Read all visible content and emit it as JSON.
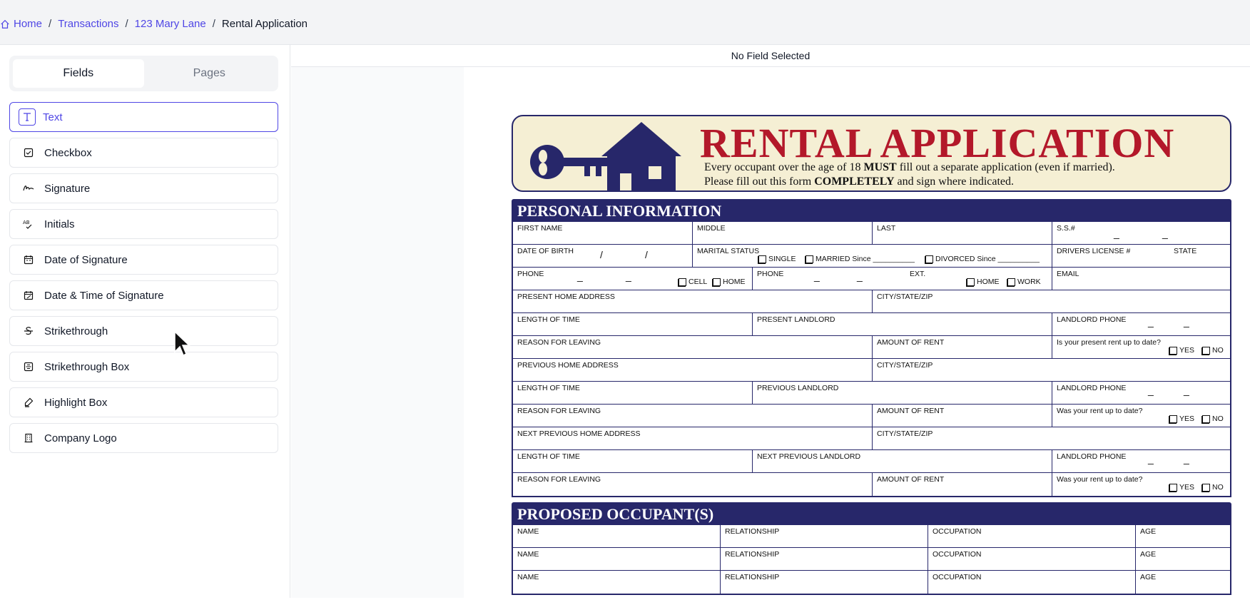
{
  "breadcrumb": {
    "items": [
      "Home",
      "Transactions",
      "123 Mary Lane"
    ],
    "current": "Rental Application",
    "separator": "/"
  },
  "sidebar": {
    "tabs": [
      {
        "label": "Fields",
        "active": true
      },
      {
        "label": "Pages",
        "active": false
      }
    ],
    "fields": [
      {
        "label": "Text",
        "icon": "text-icon",
        "selected": true
      },
      {
        "label": "Checkbox",
        "icon": "checkbox-icon"
      },
      {
        "label": "Signature",
        "icon": "signature-icon"
      },
      {
        "label": "Initials",
        "icon": "initials-icon"
      },
      {
        "label": "Date of Signature",
        "icon": "calendar-icon"
      },
      {
        "label": "Date & Time of Signature",
        "icon": "calendar-clock-icon"
      },
      {
        "label": "Strikethrough",
        "icon": "strikethrough-icon"
      },
      {
        "label": "Strikethrough Box",
        "icon": "strikethrough-box-icon"
      },
      {
        "label": "Highlight Box",
        "icon": "highlighter-icon"
      },
      {
        "label": "Company Logo",
        "icon": "building-icon"
      }
    ]
  },
  "main": {
    "status": "No Field Selected"
  },
  "document": {
    "title": "RENTAL APPLICATION",
    "subtitle_line1_a": "Every occupant over the age of 18 ",
    "subtitle_line1_b": "MUST",
    "subtitle_line1_c": " fill out a separate application (even if married).",
    "subtitle_line2_a": "Please fill out this form ",
    "subtitle_line2_b": "COMPLETELY",
    "subtitle_line2_c": " and sign where indicated.",
    "personal_heading": "PERSONAL INFORMATION",
    "occupants_heading": "PROPOSED OCCUPANT(S)",
    "labels": {
      "first_name": "FIRST NAME",
      "middle": "MIDDLE",
      "last": "LAST",
      "ss": "S.S.#",
      "dob": "DATE OF BIRTH",
      "marital": "MARITAL STATUS",
      "single": "SINGLE",
      "married": "MARRIED",
      "since": "Since",
      "divorced": "DIVORCED",
      "license": "DRIVERS LICENSE #",
      "state": "STATE",
      "phone": "PHONE",
      "cell": "CELL",
      "home": "HOME",
      "ext": "EXT.",
      "work": "WORK",
      "email": "EMAIL",
      "present_address": "PRESENT HOME ADDRESS",
      "city_state_zip": "CITY/STATE/ZIP",
      "length_of_time": "LENGTH OF TIME",
      "present_landlord": "PRESENT LANDLORD",
      "landlord_phone": "LANDLORD PHONE",
      "reason": "REASON FOR LEAVING",
      "amount_rent": "AMOUNT OF RENT",
      "present_rent_q": "Is your present rent up to date?",
      "yes": "YES",
      "no": "NO",
      "previous_address": "PREVIOUS HOME ADDRESS",
      "previous_landlord": "PREVIOUS LANDLORD",
      "was_rent_q": "Was your rent up to date?",
      "next_previous_address": "NEXT PREVIOUS HOME ADDRESS",
      "next_previous_landlord": "NEXT PREVIOUS LANDLORD",
      "name": "NAME",
      "relationship": "RELATIONSHIP",
      "occupation": "OCCUPATION",
      "age": "AGE"
    }
  },
  "colors": {
    "accent": "#4f46e5",
    "navy": "#27276a",
    "title_red": "#b3182a",
    "banner_bg": "#f5efd4"
  }
}
